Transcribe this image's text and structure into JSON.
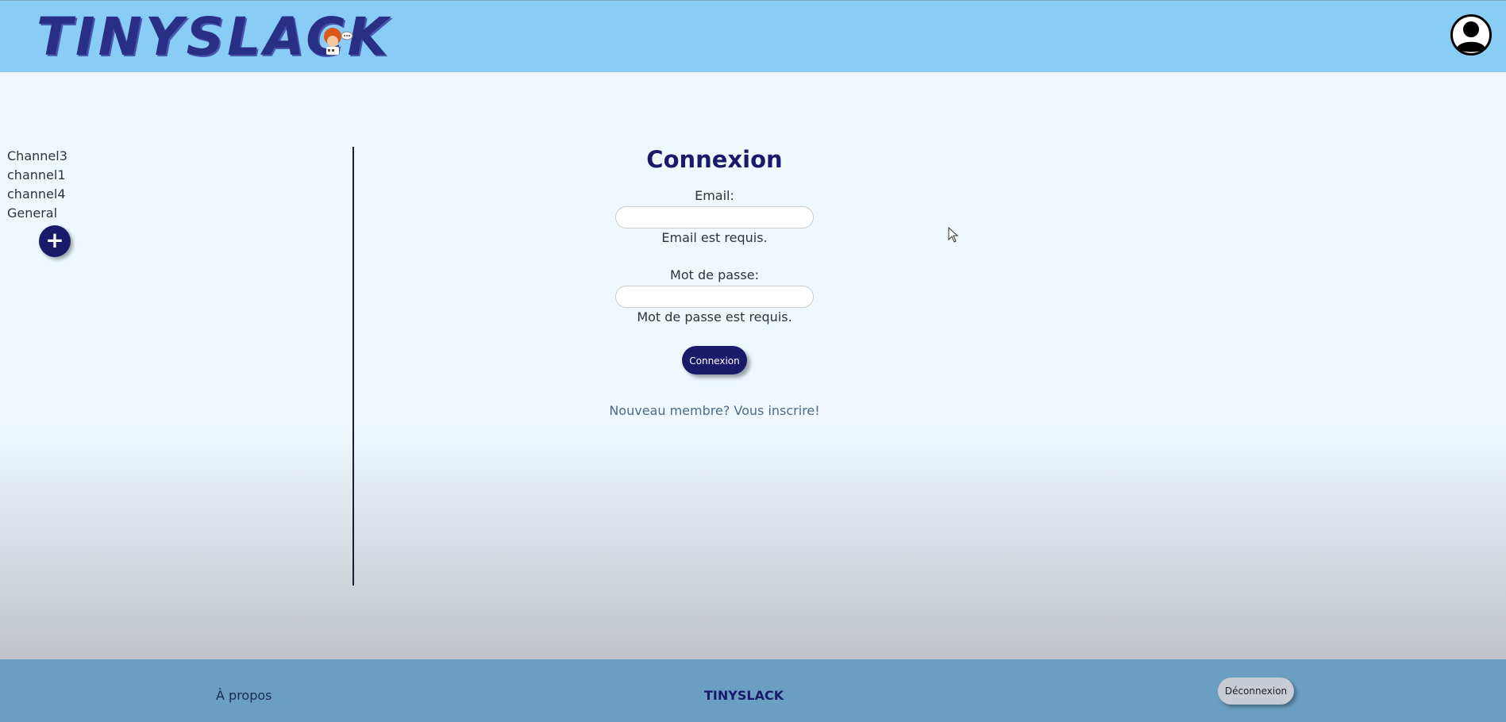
{
  "header": {
    "logo_text": "TINYSLACK",
    "profile_icon": "user-avatar-icon"
  },
  "sidebar": {
    "channels": [
      "Channel3",
      "channel1",
      "channel4",
      "General"
    ],
    "add_icon": "plus-icon",
    "add_label": "+"
  },
  "login": {
    "title": "Connexion",
    "email_label": "Email:",
    "email_value": "",
    "email_error": "Email est requis.",
    "password_label": "Mot de passe:",
    "password_value": "",
    "password_error": "Mot de passe est requis.",
    "submit_label": "Connexion",
    "signup_link": "Nouveau membre? Vous inscrire!"
  },
  "footer": {
    "about_link": "À propos",
    "brand": "TINYSLACK",
    "logout_label": "Déconnexion"
  },
  "colors": {
    "header_bg": "#89cdf7",
    "primary": "#1a1a6b",
    "footer_bg": "#6a9fc1",
    "page_bg": "#eff8ff"
  }
}
